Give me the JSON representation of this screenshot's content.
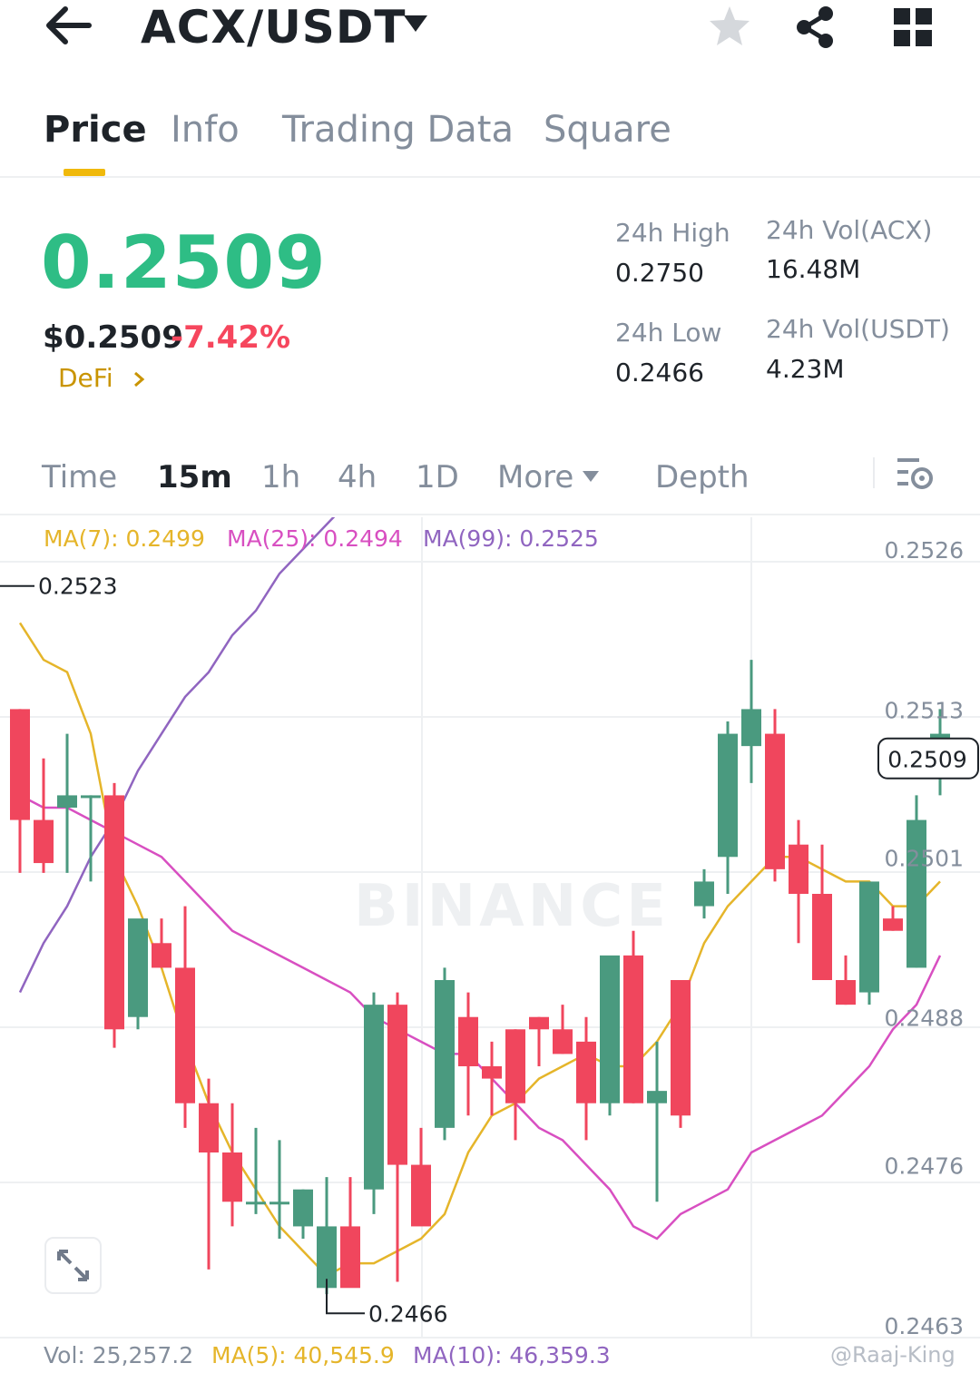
{
  "header": {
    "pair": "ACX/USDT",
    "icons": [
      "back-arrow-icon",
      "caret-down-icon",
      "star-icon",
      "share-icon",
      "grid-icon"
    ]
  },
  "tabs": [
    {
      "label": "Price",
      "active": true
    },
    {
      "label": "Info",
      "active": false
    },
    {
      "label": "Trading Data",
      "active": false
    },
    {
      "label": "Square",
      "active": false
    }
  ],
  "ticker": {
    "last_price": "0.2509",
    "usd_price": "$0.2509",
    "change_pct": "-7.42%",
    "tag": "DeFi",
    "high_label": "24h High",
    "high_value": "0.2750",
    "low_label": "24h Low",
    "low_value": "0.2466",
    "vol_base_label": "24h Vol(ACX)",
    "vol_base_value": "16.48M",
    "vol_quote_label": "24h Vol(USDT)",
    "vol_quote_value": "4.23M",
    "up_color": "#2ebd85",
    "down_color": "#f6465d"
  },
  "intervals": {
    "items": [
      "Time",
      "15m",
      "1h",
      "4h",
      "1D",
      "More",
      "Depth"
    ],
    "active": "15m"
  },
  "ma_legend": {
    "ma7": "MA(7): 0.2499",
    "ma25": "MA(25): 0.2494",
    "ma99": "MA(99): 0.2525",
    "ma7_color": "#e5b52a",
    "ma25_color": "#d84fc1",
    "ma99_color": "#9065c0"
  },
  "chart_data": {
    "type": "candlestick",
    "ylim": [
      0.2463,
      0.2526
    ],
    "yticks": [
      "0.2526",
      "0.2513",
      "0.2501",
      "0.2488",
      "0.2476",
      "0.2463"
    ],
    "current_price_label": "0.2509",
    "max_label": "0.2523",
    "min_label": "0.2466",
    "watermark": "BINANCE",
    "candles": [
      {
        "o": 0.2513,
        "h": 0.2513,
        "l": 0.24997,
        "c": 0.2504
      },
      {
        "o": 0.2504,
        "h": 0.2509,
        "l": 0.24997,
        "c": 0.25005
      },
      {
        "o": 0.2505,
        "h": 0.2511,
        "l": 0.24997,
        "c": 0.2506
      },
      {
        "o": 0.2506,
        "h": 0.2506,
        "l": 0.2499,
        "c": 0.2506
      },
      {
        "o": 0.2506,
        "h": 0.2507,
        "l": 0.24855,
        "c": 0.2487
      },
      {
        "o": 0.2488,
        "h": 0.2495,
        "l": 0.2487,
        "c": 0.2496
      },
      {
        "o": 0.2494,
        "h": 0.2496,
        "l": 0.2492,
        "c": 0.2492
      },
      {
        "o": 0.2492,
        "h": 0.2497,
        "l": 0.2479,
        "c": 0.2481
      },
      {
        "o": 0.2481,
        "h": 0.2483,
        "l": 0.24675,
        "c": 0.2477
      },
      {
        "o": 0.2477,
        "h": 0.2481,
        "l": 0.2471,
        "c": 0.2473
      },
      {
        "o": 0.2473,
        "h": 0.2479,
        "l": 0.2472,
        "c": 0.2473
      },
      {
        "o": 0.2473,
        "h": 0.2478,
        "l": 0.247,
        "c": 0.2473
      },
      {
        "o": 0.2471,
        "h": 0.2474,
        "l": 0.247,
        "c": 0.2474
      },
      {
        "o": 0.2466,
        "h": 0.2475,
        "l": 0.24655,
        "c": 0.2471
      },
      {
        "o": 0.2471,
        "h": 0.2475,
        "l": 0.24665,
        "c": 0.2466
      },
      {
        "o": 0.2474,
        "h": 0.249,
        "l": 0.2472,
        "c": 0.2489
      },
      {
        "o": 0.2489,
        "h": 0.249,
        "l": 0.24665,
        "c": 0.2476
      },
      {
        "o": 0.2476,
        "h": 0.2479,
        "l": 0.2472,
        "c": 0.2471
      },
      {
        "o": 0.2479,
        "h": 0.2492,
        "l": 0.2478,
        "c": 0.2491
      },
      {
        "o": 0.2488,
        "h": 0.249,
        "l": 0.248,
        "c": 0.2484
      },
      {
        "o": 0.2484,
        "h": 0.2486,
        "l": 0.248,
        "c": 0.2483
      },
      {
        "o": 0.2487,
        "h": 0.2487,
        "l": 0.2478,
        "c": 0.2481
      },
      {
        "o": 0.2488,
        "h": 0.2488,
        "l": 0.2484,
        "c": 0.2487
      },
      {
        "o": 0.2487,
        "h": 0.2489,
        "l": 0.2485,
        "c": 0.2485
      },
      {
        "o": 0.2486,
        "h": 0.2488,
        "l": 0.2478,
        "c": 0.2481
      },
      {
        "o": 0.2481,
        "h": 0.2491,
        "l": 0.248,
        "c": 0.2493
      },
      {
        "o": 0.2493,
        "h": 0.2495,
        "l": 0.2481,
        "c": 0.2481
      },
      {
        "o": 0.2481,
        "h": 0.2486,
        "l": 0.2473,
        "c": 0.2482
      },
      {
        "o": 0.2491,
        "h": 0.2491,
        "l": 0.2479,
        "c": 0.248
      },
      {
        "o": 0.2497,
        "h": 0.25,
        "l": 0.2496,
        "c": 0.2499
      },
      {
        "o": 0.2501,
        "h": 0.2512,
        "l": 0.2498,
        "c": 0.2511
      },
      {
        "o": 0.251,
        "h": 0.2517,
        "l": 0.2507,
        "c": 0.2513
      },
      {
        "o": 0.2511,
        "h": 0.2513,
        "l": 0.2499,
        "c": 0.25
      },
      {
        "o": 0.2502,
        "h": 0.2504,
        "l": 0.2494,
        "c": 0.2498
      },
      {
        "o": 0.2498,
        "h": 0.2502,
        "l": 0.2491,
        "c": 0.2491
      },
      {
        "o": 0.2491,
        "h": 0.2493,
        "l": 0.2489,
        "c": 0.2489
      },
      {
        "o": 0.249,
        "h": 0.2498,
        "l": 0.2489,
        "c": 0.2499
      },
      {
        "o": 0.2496,
        "h": 0.2497,
        "l": 0.2495,
        "c": 0.2495
      },
      {
        "o": 0.2492,
        "h": 0.2506,
        "l": 0.2492,
        "c": 0.2504
      },
      {
        "o": 0.2509,
        "h": 0.2513,
        "l": 0.2506,
        "c": 0.2511
      }
    ],
    "ma7": [
      0.252,
      0.2517,
      0.2516,
      0.2511,
      0.2501,
      0.2497,
      0.2492,
      0.2486,
      0.2481,
      0.2477,
      0.2474,
      0.2471,
      0.2469,
      0.2467,
      0.2468,
      0.2468,
      0.2469,
      0.247,
      0.2472,
      0.2477,
      0.248,
      0.2481,
      0.2483,
      0.2484,
      0.2485,
      0.2484,
      0.2484,
      0.2486,
      0.2489,
      0.2494,
      0.2497,
      0.2499,
      0.2501,
      0.2501,
      0.25,
      0.2499,
      0.2499,
      0.2497,
      0.2497,
      0.2499
    ],
    "ma25": [
      0.2506,
      0.2505,
      0.2505,
      0.2504,
      0.2503,
      0.2502,
      0.2501,
      0.2499,
      0.2497,
      0.2495,
      0.2494,
      0.2493,
      0.2492,
      0.2491,
      0.249,
      0.2488,
      0.2487,
      0.2486,
      0.2485,
      0.2485,
      0.2483,
      0.2481,
      0.2479,
      0.2478,
      0.2476,
      0.2474,
      0.2471,
      0.247,
      0.2472,
      0.2473,
      0.2474,
      0.2477,
      0.2478,
      0.2479,
      0.248,
      0.2482,
      0.2484,
      0.2487,
      0.2489,
      0.2493
    ],
    "ma99": [
      0.249,
      0.2494,
      0.2497,
      0.2501,
      0.2504,
      0.2508,
      0.2511,
      0.2514,
      0.2516,
      0.2519,
      0.2521,
      0.2524,
      0.2526,
      0.2528,
      0.253,
      0.2532,
      0.2533,
      0.2535,
      0.2537,
      0.2538,
      0.254,
      0.2541,
      0.2542,
      0.2543,
      0.2544,
      0.2546,
      0.2547,
      0.2548,
      0.255,
      0.2552,
      0.2553,
      0.2554,
      0.2556,
      0.2557,
      0.2558,
      0.2559,
      0.256,
      0.256,
      0.256,
      0.2559
    ]
  },
  "volume_legend": {
    "vol": "Vol: 25,257.2",
    "ma5": "MA(5): 40,545.9",
    "ma10": "MA(10): 46,359.3",
    "vol_color": "#848e9c",
    "ma5_color": "#e5b52a",
    "ma10_color": "#9065c0"
  },
  "watermark_credit": "@Raaj-King"
}
